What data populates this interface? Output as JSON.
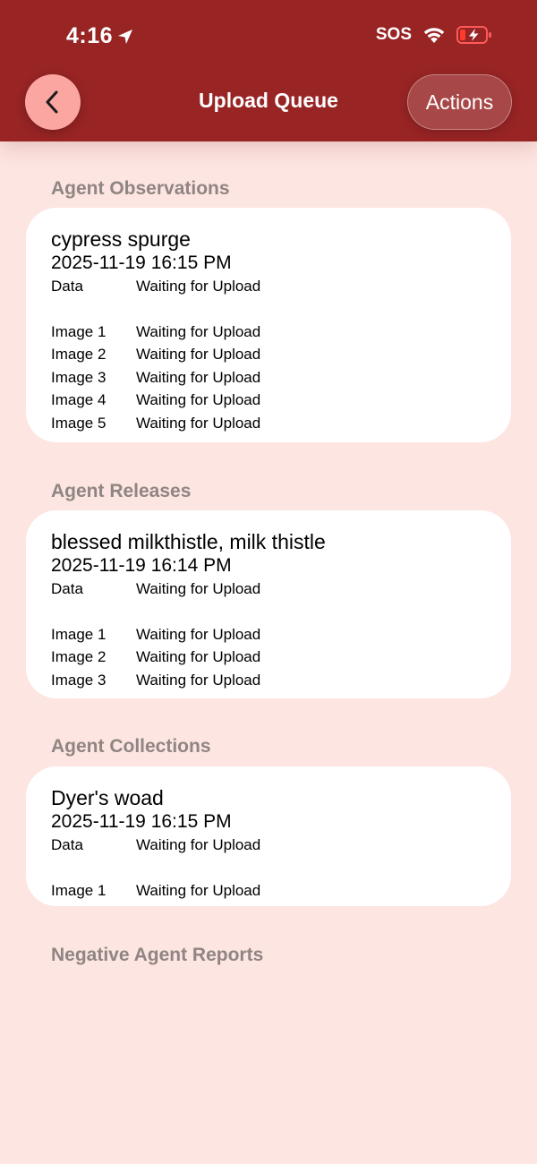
{
  "status_bar": {
    "time": "4:16",
    "sos": "SOS",
    "icons": [
      "location-arrow-icon",
      "wifi-icon",
      "battery-charging-icon"
    ]
  },
  "nav": {
    "back_icon": "chevron-left-icon",
    "title": "Upload Queue",
    "actions_label": "Actions"
  },
  "colors": {
    "header_bg": "#982424",
    "page_bg": "#fde5e1",
    "back_button_bg": "#fca6a2",
    "section_header_text": "#8f8582",
    "card_bg": "#ffffff"
  },
  "sections": [
    {
      "header": "Agent Observations",
      "items": [
        {
          "name": "cypress spurge",
          "date": "2025-11-19 16:15 PM",
          "data_row": {
            "label": "Data",
            "status": "Waiting for Upload"
          },
          "images": [
            {
              "label": "Image 1",
              "status": "Waiting for Upload"
            },
            {
              "label": "Image 2",
              "status": "Waiting for Upload"
            },
            {
              "label": "Image 3",
              "status": "Waiting for Upload"
            },
            {
              "label": "Image 4",
              "status": "Waiting for Upload"
            },
            {
              "label": "Image 5",
              "status": "Waiting for Upload"
            }
          ]
        }
      ]
    },
    {
      "header": "Agent Releases",
      "items": [
        {
          "name": "blessed milkthistle, milk thistle",
          "date": "2025-11-19 16:14 PM",
          "data_row": {
            "label": "Data",
            "status": "Waiting for Upload"
          },
          "images": [
            {
              "label": "Image 1",
              "status": "Waiting for Upload"
            },
            {
              "label": "Image 2",
              "status": "Waiting for Upload"
            },
            {
              "label": "Image 3",
              "status": "Waiting for Upload"
            }
          ]
        }
      ]
    },
    {
      "header": "Agent Collections",
      "items": [
        {
          "name": "Dyer's woad",
          "date": "2025-11-19 16:15 PM",
          "data_row": {
            "label": "Data",
            "status": "Waiting for Upload"
          },
          "images": [
            {
              "label": "Image 1",
              "status": "Waiting for Upload"
            }
          ]
        }
      ]
    },
    {
      "header": "Negative Agent Reports",
      "items": []
    }
  ]
}
